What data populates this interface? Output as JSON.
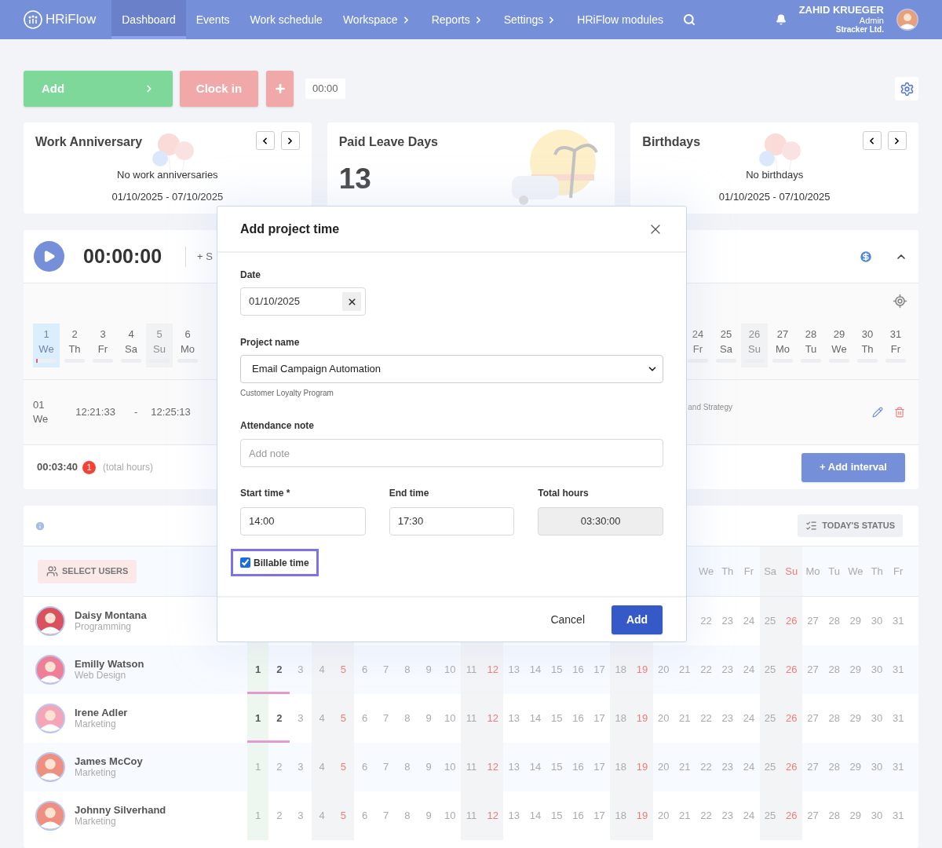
{
  "nav": {
    "logo": "HRiFlow",
    "items": [
      {
        "label": "Dashboard",
        "selected": true,
        "submenu": false
      },
      {
        "label": "Events",
        "selected": false,
        "submenu": false
      },
      {
        "label": "Work schedule",
        "selected": false,
        "submenu": false
      },
      {
        "label": "Workspace",
        "selected": false,
        "submenu": true
      },
      {
        "label": "Reports",
        "selected": false,
        "submenu": true
      },
      {
        "label": "Settings",
        "selected": false,
        "submenu": true
      },
      {
        "label": "HRiFlow modules",
        "selected": false,
        "submenu": false
      }
    ],
    "user": {
      "name": "ZAHID KRUEGER",
      "role": "Admin",
      "company": "Stracker Ltd."
    }
  },
  "toolbar": {
    "add": "Add",
    "clock_in": "Clock in",
    "time": "00:00"
  },
  "cards": [
    {
      "kind": "range",
      "title": "Work Anniversary",
      "message": "No work anniversaries",
      "range": "01/10/2025 - 07/10/2025"
    },
    {
      "kind": "count",
      "title": "Paid Leave Days",
      "value": "13"
    },
    {
      "kind": "range",
      "title": "Birthdays",
      "message": "No birthdays",
      "range": "01/10/2025 - 07/10/2025"
    }
  ],
  "timer": {
    "time": "00:00:00",
    "action": "+ S",
    "days_left": [
      {
        "day": "1",
        "weekday": "We",
        "selected": true,
        "off": false
      },
      {
        "day": "2",
        "weekday": "Th",
        "selected": false,
        "off": false
      },
      {
        "day": "3",
        "weekday": "Fr",
        "selected": false,
        "off": false
      },
      {
        "day": "4",
        "weekday": "Sa",
        "selected": false,
        "off": false
      },
      {
        "day": "5",
        "weekday": "Su",
        "selected": false,
        "off": true
      },
      {
        "day": "6",
        "weekday": "Mo",
        "selected": false,
        "off": false
      }
    ],
    "days_right": [
      {
        "day": "24",
        "weekday": "Fr",
        "selected": false,
        "off": false
      },
      {
        "day": "25",
        "weekday": "Sa",
        "selected": false,
        "off": false
      },
      {
        "day": "26",
        "weekday": "Su",
        "selected": false,
        "off": true
      },
      {
        "day": "27",
        "weekday": "Mo",
        "selected": false,
        "off": false
      },
      {
        "day": "28",
        "weekday": "Tu",
        "selected": false,
        "off": false
      },
      {
        "day": "29",
        "weekday": "We",
        "selected": false,
        "off": false
      },
      {
        "day": "30",
        "weekday": "Th",
        "selected": false,
        "off": false
      },
      {
        "day": "31",
        "weekday": "Fr",
        "selected": false,
        "off": false
      }
    ],
    "entry": {
      "day": "01",
      "weekday": "We",
      "start": "12:21:33",
      "dash": "-",
      "end": "12:25:13",
      "project": "and Strategy"
    },
    "total": "00:03:40",
    "badge": "1",
    "total_label": "(total hours)",
    "add_interval": "+ Add interval"
  },
  "attendance": {
    "status_button": "TODAY'S STATUS",
    "select_users": "SELECT USERS",
    "columns": [
      {
        "kind": "today"
      },
      {
        "kind": "weekday"
      },
      {
        "kind": "weekday"
      },
      {
        "kind": "saturday"
      },
      {
        "kind": "sunday"
      },
      {
        "kind": "weekday"
      },
      {
        "kind": "weekday"
      },
      {
        "kind": "weekday"
      },
      {
        "kind": "weekday"
      },
      {
        "kind": "weekday"
      },
      {
        "kind": "saturday"
      },
      {
        "kind": "sunday"
      },
      {
        "kind": "weekday"
      },
      {
        "kind": "weekday"
      },
      {
        "kind": "weekday"
      },
      {
        "kind": "weekday"
      },
      {
        "kind": "weekday"
      },
      {
        "kind": "saturday"
      },
      {
        "kind": "sunday"
      },
      {
        "kind": "weekday"
      },
      {
        "kind": "weekday"
      },
      {
        "kind": "weekday"
      },
      {
        "kind": "weekday"
      },
      {
        "kind": "weekday"
      },
      {
        "kind": "saturday"
      },
      {
        "kind": "sunday"
      },
      {
        "kind": "weekday"
      },
      {
        "kind": "weekday"
      },
      {
        "kind": "weekday"
      },
      {
        "kind": "weekday"
      },
      {
        "kind": "weekday"
      }
    ],
    "weekdays": [
      "We",
      "Th",
      "Fr",
      "Sa",
      "Su",
      "Mo",
      "Tu",
      "We",
      "Th",
      "Fr"
    ],
    "employees": [
      {
        "name": "Daisy Montana",
        "department": "Programming",
        "days": [
          {
            "label": "22",
            "worked": false
          },
          {
            "label": "23",
            "worked": false
          },
          {
            "label": "24",
            "worked": false
          },
          {
            "label": "25",
            "worked": false
          },
          {
            "label": "26",
            "worked": false
          },
          {
            "label": "27",
            "worked": false
          },
          {
            "label": "28",
            "worked": false
          },
          {
            "label": "29",
            "worked": false
          },
          {
            "label": "30",
            "worked": false
          },
          {
            "label": "31",
            "worked": false
          }
        ]
      },
      {
        "name": "Emilly Watson",
        "department": "Web Design",
        "days": [
          {
            "label": "1",
            "worked": true
          },
          {
            "label": "2",
            "worked": true
          },
          {
            "label": "3",
            "worked": false
          },
          {
            "label": "4",
            "worked": false
          },
          {
            "label": "5",
            "worked": false
          },
          {
            "label": "6",
            "worked": false
          },
          {
            "label": "7",
            "worked": false
          },
          {
            "label": "8",
            "worked": false
          },
          {
            "label": "9",
            "worked": false
          },
          {
            "label": "10",
            "worked": false
          },
          {
            "label": "11",
            "worked": false
          },
          {
            "label": "12",
            "worked": false
          },
          {
            "label": "13",
            "worked": false
          },
          {
            "label": "14",
            "worked": false
          },
          {
            "label": "15",
            "worked": false
          },
          {
            "label": "16",
            "worked": false
          },
          {
            "label": "17",
            "worked": false
          },
          {
            "label": "18",
            "worked": false
          },
          {
            "label": "19",
            "worked": false
          },
          {
            "label": "20",
            "worked": false
          },
          {
            "label": "21",
            "worked": false
          },
          {
            "label": "22",
            "worked": false
          },
          {
            "label": "23",
            "worked": false
          },
          {
            "label": "24",
            "worked": false
          },
          {
            "label": "25",
            "worked": false
          },
          {
            "label": "26",
            "worked": false
          },
          {
            "label": "27",
            "worked": false
          },
          {
            "label": "28",
            "worked": false
          },
          {
            "label": "29",
            "worked": false
          },
          {
            "label": "30",
            "worked": false
          },
          {
            "label": "31",
            "worked": false
          }
        ]
      },
      {
        "name": "Irene Adler",
        "department": "Marketing",
        "days": [
          {
            "label": "1",
            "worked": true
          },
          {
            "label": "2",
            "worked": true
          },
          {
            "label": "3",
            "worked": false
          },
          {
            "label": "4",
            "worked": false
          },
          {
            "label": "5",
            "worked": false
          },
          {
            "label": "6",
            "worked": false
          },
          {
            "label": "7",
            "worked": false
          },
          {
            "label": "8",
            "worked": false
          },
          {
            "label": "9",
            "worked": false
          },
          {
            "label": "10",
            "worked": false
          },
          {
            "label": "11",
            "worked": false
          },
          {
            "label": "12",
            "worked": false
          },
          {
            "label": "13",
            "worked": false
          },
          {
            "label": "14",
            "worked": false
          },
          {
            "label": "15",
            "worked": false
          },
          {
            "label": "16",
            "worked": false
          },
          {
            "label": "17",
            "worked": false
          },
          {
            "label": "18",
            "worked": false
          },
          {
            "label": "19",
            "worked": false
          },
          {
            "label": "20",
            "worked": false
          },
          {
            "label": "21",
            "worked": false
          },
          {
            "label": "22",
            "worked": false
          },
          {
            "label": "23",
            "worked": false
          },
          {
            "label": "24",
            "worked": false
          },
          {
            "label": "25",
            "worked": false
          },
          {
            "label": "26",
            "worked": false
          },
          {
            "label": "27",
            "worked": false
          },
          {
            "label": "28",
            "worked": false
          },
          {
            "label": "29",
            "worked": false
          },
          {
            "label": "30",
            "worked": false
          },
          {
            "label": "31",
            "worked": false
          }
        ]
      },
      {
        "name": "James McCoy",
        "department": "Marketing",
        "days": [
          {
            "label": "1",
            "worked": false
          },
          {
            "label": "2",
            "worked": false
          },
          {
            "label": "3",
            "worked": false
          },
          {
            "label": "4",
            "worked": false
          },
          {
            "label": "5",
            "worked": false
          },
          {
            "label": "6",
            "worked": false
          },
          {
            "label": "7",
            "worked": false
          },
          {
            "label": "8",
            "worked": false
          },
          {
            "label": "9",
            "worked": false
          },
          {
            "label": "10",
            "worked": false
          },
          {
            "label": "11",
            "worked": false
          },
          {
            "label": "12",
            "worked": false
          },
          {
            "label": "13",
            "worked": false
          },
          {
            "label": "14",
            "worked": false
          },
          {
            "label": "15",
            "worked": false
          },
          {
            "label": "16",
            "worked": false
          },
          {
            "label": "17",
            "worked": false
          },
          {
            "label": "18",
            "worked": false
          },
          {
            "label": "19",
            "worked": false
          },
          {
            "label": "20",
            "worked": false
          },
          {
            "label": "21",
            "worked": false
          },
          {
            "label": "22",
            "worked": false
          },
          {
            "label": "23",
            "worked": false
          },
          {
            "label": "24",
            "worked": false
          },
          {
            "label": "25",
            "worked": false
          },
          {
            "label": "26",
            "worked": false
          },
          {
            "label": "27",
            "worked": false
          },
          {
            "label": "28",
            "worked": false
          },
          {
            "label": "29",
            "worked": false
          },
          {
            "label": "30",
            "worked": false
          },
          {
            "label": "31",
            "worked": false
          }
        ]
      },
      {
        "name": "Johnny Silverhand",
        "department": "Marketing",
        "days": [
          {
            "label": "1",
            "worked": false
          },
          {
            "label": "2",
            "worked": false
          },
          {
            "label": "3",
            "worked": false
          },
          {
            "label": "4",
            "worked": false
          },
          {
            "label": "5",
            "worked": false
          },
          {
            "label": "6",
            "worked": false
          },
          {
            "label": "7",
            "worked": false
          },
          {
            "label": "8",
            "worked": false
          },
          {
            "label": "9",
            "worked": false
          },
          {
            "label": "10",
            "worked": false
          },
          {
            "label": "11",
            "worked": false
          },
          {
            "label": "12",
            "worked": false
          },
          {
            "label": "13",
            "worked": false
          },
          {
            "label": "14",
            "worked": false
          },
          {
            "label": "15",
            "worked": false
          },
          {
            "label": "16",
            "worked": false
          },
          {
            "label": "17",
            "worked": false
          },
          {
            "label": "18",
            "worked": false
          },
          {
            "label": "19",
            "worked": false
          },
          {
            "label": "20",
            "worked": false
          },
          {
            "label": "21",
            "worked": false
          },
          {
            "label": "22",
            "worked": false
          },
          {
            "label": "23",
            "worked": false
          },
          {
            "label": "24",
            "worked": false
          },
          {
            "label": "25",
            "worked": false
          },
          {
            "label": "26",
            "worked": false
          },
          {
            "label": "27",
            "worked": false
          },
          {
            "label": "28",
            "worked": false
          },
          {
            "label": "29",
            "worked": false
          },
          {
            "label": "30",
            "worked": false
          },
          {
            "label": "31",
            "worked": false
          }
        ]
      }
    ]
  },
  "dialog": {
    "title": "Add project time",
    "date": {
      "label": "Date",
      "value": "01/10/2025"
    },
    "project": {
      "label": "Project name",
      "value": "Email Campaign Automation",
      "hint": "Customer Loyalty Program"
    },
    "note": {
      "label": "Attendance note",
      "placeholder": "Add note"
    },
    "start": {
      "label": "Start time *",
      "value": "14:00"
    },
    "end": {
      "label": "End time",
      "value": "17:30"
    },
    "total": {
      "label": "Total hours",
      "value": "03:30:00",
      "disabled": true
    },
    "billable": {
      "label": "Billable time",
      "checked": true,
      "focused": true
    },
    "cancel": "Cancel",
    "submit": "Add"
  }
}
